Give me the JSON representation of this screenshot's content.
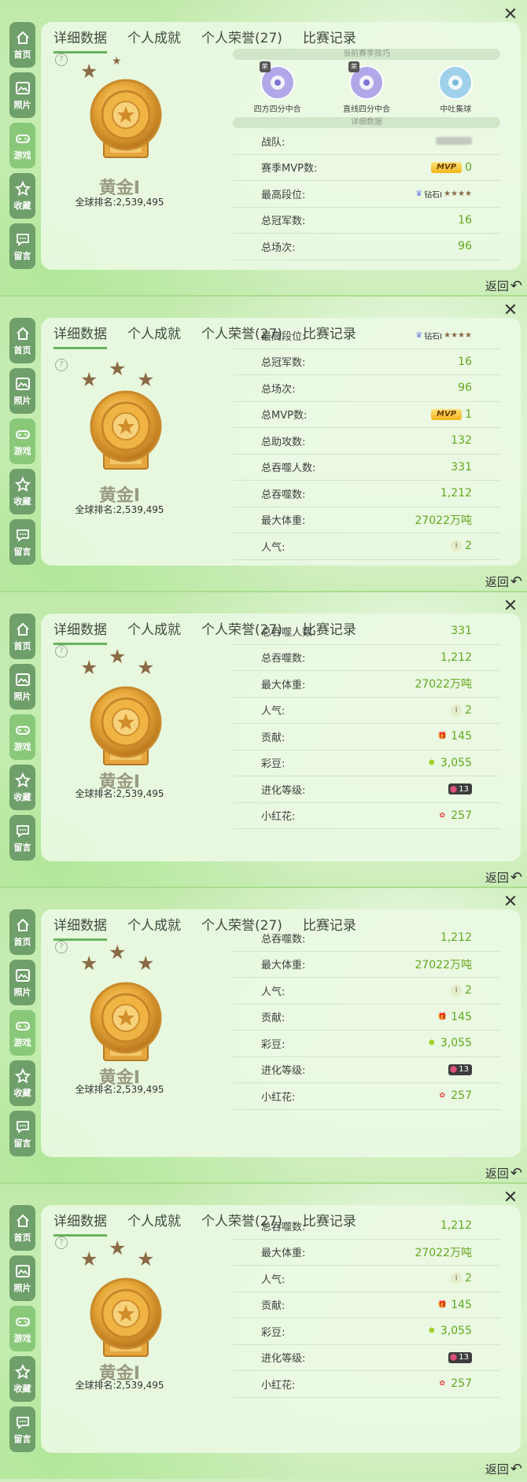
{
  "close_label": "✕",
  "sidebar": [
    {
      "label": "首页",
      "icon": "home-icon"
    },
    {
      "label": "照片",
      "icon": "photo-icon"
    },
    {
      "label": "游戏",
      "icon": "gamepad-icon"
    },
    {
      "label": "收藏",
      "icon": "star-badge-icon"
    },
    {
      "label": "留言",
      "icon": "message-icon"
    }
  ],
  "tabs": [
    "详细数据",
    "个人成就",
    "个人荣誉(27)",
    "比赛记录"
  ],
  "rank": {
    "name": "黄金Ⅰ",
    "global_rank": "全球排名:2,539,495"
  },
  "skills_header": "当前赛季技巧",
  "skills": [
    {
      "name": "四方四分中合",
      "badge": "荣"
    },
    {
      "name": "直线四分中合",
      "badge": "荣"
    },
    {
      "name": "中吐集球",
      "badge": ""
    }
  ],
  "detail_header": "详细数据",
  "stats": {
    "team": {
      "label": "战队:"
    },
    "season_mvp": {
      "label": "赛季MVP数:",
      "badge": "MVP",
      "value": "0"
    },
    "top_rank": {
      "label": "最高段位:",
      "value": "钻石Ⅰ",
      "stars": "★★★★"
    },
    "champions": {
      "label": "总冠军数:",
      "value": "16"
    },
    "games": {
      "label": "总场次:",
      "value": "96"
    },
    "mvp_total": {
      "label": "总MVP数:",
      "badge": "MVP",
      "value": "1"
    },
    "assists": {
      "label": "总助攻数:",
      "value": "132"
    },
    "eat_players": {
      "label": "总吞噬人数:",
      "value": "331"
    },
    "eats": {
      "label": "总吞噬数:",
      "value": "1,212"
    },
    "max_weight": {
      "label": "最大体重:",
      "value": "27022万吨"
    },
    "popularity": {
      "label": "人气:",
      "value": "2"
    },
    "contribution": {
      "label": "贡献:",
      "value": "145"
    },
    "beans": {
      "label": "彩豆:",
      "value": "3,055"
    },
    "evolution": {
      "label": "进化等级:",
      "value": "13"
    },
    "flowers": {
      "label": "小红花:",
      "value": "257"
    }
  },
  "back_label": "返回",
  "colors": {
    "accent_green": "#62a81e",
    "sidebar": "#6f9f6a",
    "sidebar_active": "#89c879",
    "star_brown": "#8b6a46"
  }
}
